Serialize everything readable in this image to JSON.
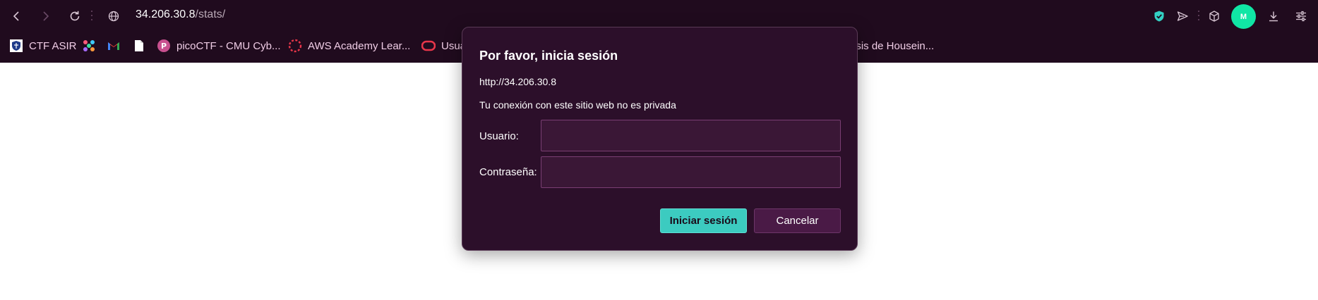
{
  "toolbar": {
    "url_host": "34.206.30.8",
    "url_path": "/stats/",
    "avatar_letter": "M",
    "icons": [
      "back-arrow-icon",
      "forward-arrow-icon",
      "reload-icon",
      "globe-icon",
      "shield-check-icon",
      "send-icon",
      "cube-icon",
      "download-icon",
      "settings-sliders-icon"
    ]
  },
  "bookmarks": [
    {
      "label": "CTF ASIR",
      "icon": "shield-crest-icon"
    },
    {
      "label": "",
      "icon": "colorful-puzzle-icon"
    },
    {
      "label": "",
      "icon": "gmail-icon"
    },
    {
      "label": "",
      "icon": "document-icon"
    },
    {
      "label": "picoCTF - CMU Cyb...",
      "icon": "picoctf-icon"
    },
    {
      "label": "AWS Academy Lear...",
      "icon": "dotted-circle-icon"
    },
    {
      "label": "Usua",
      "icon": "oracle-icon"
    },
    {
      "label": "isis de Housein...",
      "icon": ""
    }
  ],
  "dialog": {
    "title": "Por favor, inicia sesión",
    "origin": "http://34.206.30.8",
    "note": "Tu conexión con este sitio web no es privada",
    "username_label": "Usuario:",
    "username_value": "",
    "password_label": "Contraseña:",
    "password_value": "",
    "submit_label": "Iniciar sesión",
    "cancel_label": "Cancelar"
  },
  "colors": {
    "chrome_bg": "#200b1e",
    "dialog_bg": "#2c0f2a",
    "accent": "#3ccbc0",
    "avatar": "#10e6a5"
  }
}
